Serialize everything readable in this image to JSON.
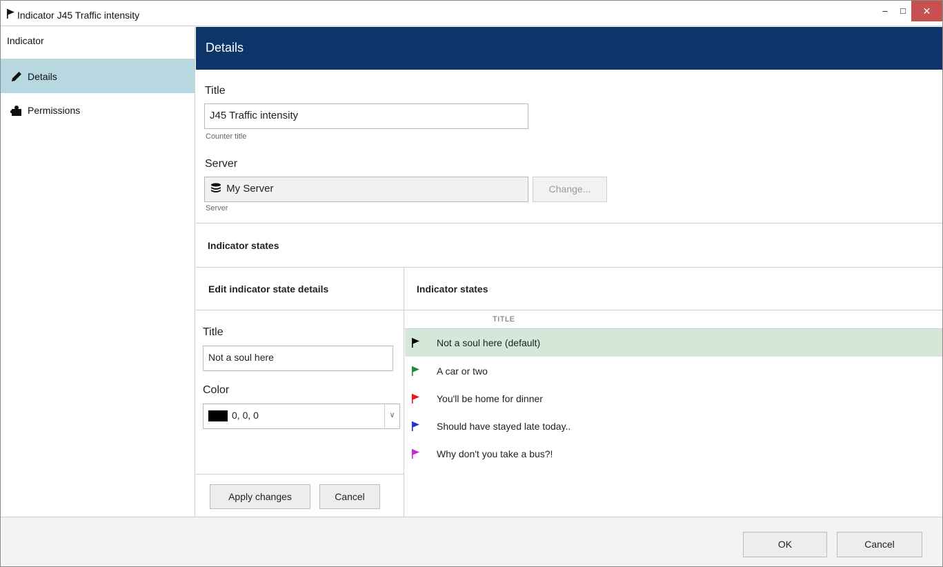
{
  "window": {
    "title": "Indicator J45 Traffic intensity",
    "minimize_glyph": "–",
    "maximize_glyph": "□",
    "close_glyph": "✕"
  },
  "sidebar": {
    "heading": "Indicator",
    "items": [
      {
        "label": "Details",
        "icon": "pencil-icon",
        "active": true
      },
      {
        "label": "Permissions",
        "icon": "puzzle-icon",
        "active": false
      }
    ]
  },
  "details": {
    "header": "Details",
    "title_label": "Title",
    "title_value": "J45 Traffic intensity",
    "title_hint": "Counter title",
    "server_label": "Server",
    "server_value": "My Server",
    "server_hint": "Server",
    "change_button": "Change..."
  },
  "states_section": {
    "heading": "Indicator states",
    "edit_heading": "Edit indicator state details",
    "list_heading": "Indicator states",
    "title_label": "Title",
    "title_value": "Not a soul here",
    "color_label": "Color",
    "color_value": "0, 0, 0",
    "color_swatch": "#000000",
    "apply_button": "Apply changes",
    "cancel_button": "Cancel",
    "column_title": "TITLE",
    "states": [
      {
        "label": "Not a soul here (default)",
        "color": "#000000",
        "selected": true
      },
      {
        "label": "A car or two",
        "color": "#1a8f2e",
        "selected": false
      },
      {
        "label": "You'll be home for dinner",
        "color": "#e8141a",
        "selected": false
      },
      {
        "label": "Should have stayed late today..",
        "color": "#1f2ee0",
        "selected": false
      },
      {
        "label": "Why don't you take a bus?!",
        "color": "#c02ad4",
        "selected": false
      }
    ]
  },
  "footer": {
    "ok_button": "OK",
    "cancel_button": "Cancel"
  },
  "colors": {
    "header_bg": "#0e3569",
    "sidebar_active": "#b7d8e0",
    "selected_row": "#d3e8d9",
    "close_button": "#c75050"
  }
}
